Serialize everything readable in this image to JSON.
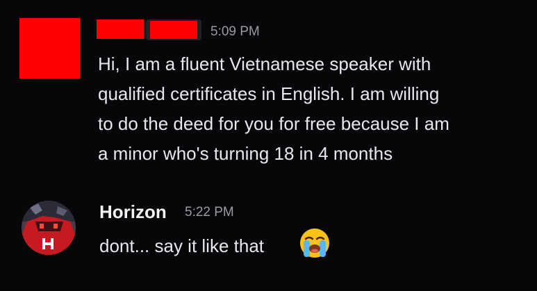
{
  "messages": [
    {
      "author": "",
      "timestamp": "5:09 PM",
      "lines": [
        "Hi, I am a fluent Vietnamese speaker with",
        "qualified certificates in English. I am willing",
        "to do the deed for you for free because I am",
        "a minor who's turning 18 in 4 months"
      ]
    },
    {
      "author": "Horizon",
      "timestamp": "5:22 PM",
      "text": "dont... say it like that",
      "emoji": "loudly-crying-face"
    }
  ],
  "colors": {
    "background": "#070709",
    "redaction": "#ff0000",
    "text": "#e8e8ec",
    "timestamp": "#9a9ba3",
    "username": "#f2f3f5"
  }
}
